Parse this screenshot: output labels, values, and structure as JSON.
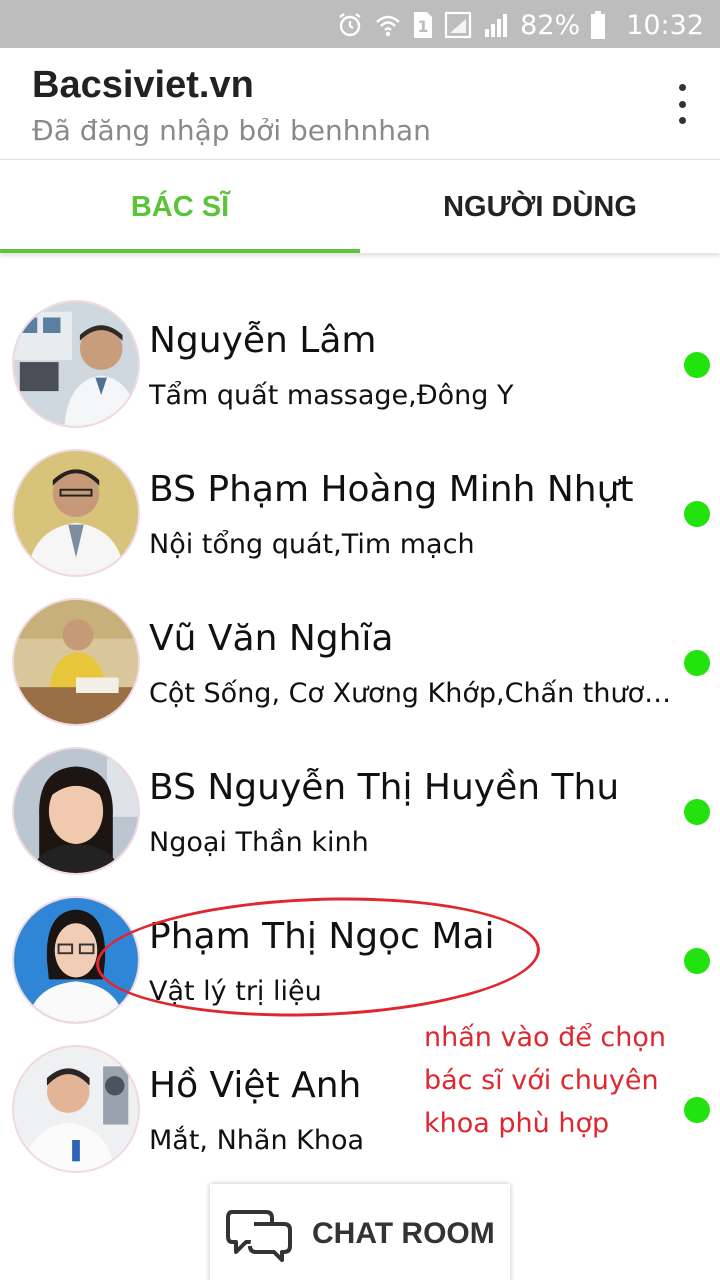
{
  "status_bar": {
    "battery_percent": "82%",
    "time": "10:32",
    "sim_label": "1"
  },
  "app_bar": {
    "title": "Bacsiviet.vn",
    "subtitle": "Đã đăng nhập bởi benhnhan"
  },
  "tabs": [
    {
      "label": "BÁC SĨ",
      "active": true
    },
    {
      "label": "NGƯỜI DÙNG",
      "active": false
    }
  ],
  "doctors": [
    {
      "name": "Nguyễn Lâm",
      "specialty": "Tẩm quất massage,Đông Y",
      "online": true
    },
    {
      "name": "BS Phạm Hoàng Minh Nhựt",
      "specialty": "Nội tổng quát,Tim  mạch",
      "online": true
    },
    {
      "name": "Vũ Văn Nghĩa",
      "specialty": "Cột Sống, Cơ Xương Khớp,Chấn thương",
      "online": true
    },
    {
      "name": "BS Nguyễn Thị Huyền Thu",
      "specialty": "Ngoại Thần kinh",
      "online": true
    },
    {
      "name": "Phạm Thị Ngọc Mai",
      "specialty": "Vật lý trị liệu",
      "online": true
    },
    {
      "name": "Hồ Việt Anh",
      "specialty": "Mắt, Nhãn Khoa",
      "online": true
    }
  ],
  "annotation": {
    "text": "nhấn vào để chọn bác sĩ với chuyên khoa phù hợp"
  },
  "chat_button": {
    "label": "CHAT ROOM"
  },
  "colors": {
    "accent_green": "#5cc43a",
    "online_dot": "#22e30e",
    "annotation_red": "#e0262f",
    "status_bar": "#bdbdbd"
  }
}
